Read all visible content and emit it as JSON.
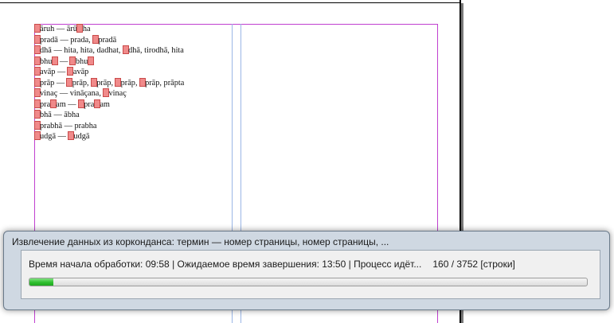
{
  "document": {
    "lines": [
      {
        "pre": "",
        "marked": true,
        "text": "āruh — ārū",
        "marked2": true,
        "post": "ha"
      },
      {
        "pre": "",
        "marked": true,
        "text": "pradā — prada, ",
        "marked2": true,
        "post": "pradā"
      },
      {
        "pre": "",
        "marked": true,
        "text": "dhā — hita, hita, dadhat, ",
        "marked2": true,
        "post": "dhā, tirodhā, hita"
      },
      {
        "pre": "",
        "marked": true,
        "text": "bhu",
        "marked2": true,
        "post": " — ",
        "marked3": true,
        "tail": "bhu",
        "marked4": true
      },
      {
        "pre": "",
        "marked": true,
        "text": "avāp — ",
        "marked2": true,
        "post": "avāp"
      },
      {
        "pre": "",
        "marked": true,
        "text": "prāp — ",
        "marked2": true,
        "post": "prāp, ",
        "marked3": true,
        "tail": "prāp, ",
        "marked4": true,
        "tail2": "prāp, ",
        "marked5": true,
        "tail3": "prāp, prāpta"
      },
      {
        "pre": "",
        "marked": true,
        "text": "vinaç — vināçana, ",
        "marked2": true,
        "post": "vinaç"
      },
      {
        "pre": "",
        "marked": true,
        "text": "pra",
        "marked2": true,
        "post": "am — ",
        "marked3": true,
        "tail": "pra",
        "marked4": true,
        "tail2": "am"
      },
      {
        "pre": "",
        "marked": true,
        "text": "bhā — ābha"
      },
      {
        "pre": "",
        "marked": true,
        "text": "prabhā — prabha"
      },
      {
        "pre": "",
        "marked": true,
        "text": "udgā — ",
        "marked2": true,
        "post": "udgā"
      }
    ]
  },
  "dialog": {
    "title": "Извлечение данных из корконданса: термин — номер страницы, номер страницы, ...",
    "start_label": "Время начала обработки: 09:58",
    "sep1": " | ",
    "eta_label": "Ожидаемое время завершения: 13:50",
    "sep2": " | ",
    "process_label": "Процесс идёт...",
    "counter": "160 / 3752 [строки]",
    "progress_fraction": 0.0425
  },
  "colors": {
    "progress": "#2fbf2f",
    "marker": "#f08a8a",
    "margin_guide": "#c040d0",
    "column_guide": "#9ab6e6"
  }
}
